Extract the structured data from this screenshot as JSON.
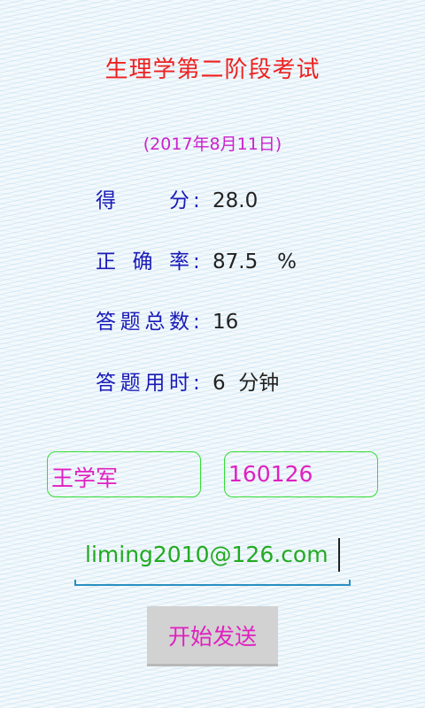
{
  "header": {
    "title": "生理学第二阶段考试",
    "date": "(2017年8月11日)"
  },
  "stats": [
    {
      "label": "得分",
      "colon": ":",
      "value": "28.0"
    },
    {
      "label": "正确率",
      "colon": ":",
      "value": "87.5   %"
    },
    {
      "label": "答题总数",
      "colon": ":",
      "value": "16"
    },
    {
      "label": "答题用时",
      "colon": ":",
      "value": "6  分钟"
    }
  ],
  "form": {
    "name_value": "王学军",
    "id_value": "160126",
    "email_value": "liming2010@126.com",
    "send_label": "开始发送"
  },
  "colors": {
    "title": "#ef2020",
    "date": "#cc22cc",
    "label": "#1a1ab8",
    "input_border": "#33dd33",
    "input_text": "#e020c0",
    "email_text": "#22aa22",
    "button_bg": "#d2d2d2"
  }
}
